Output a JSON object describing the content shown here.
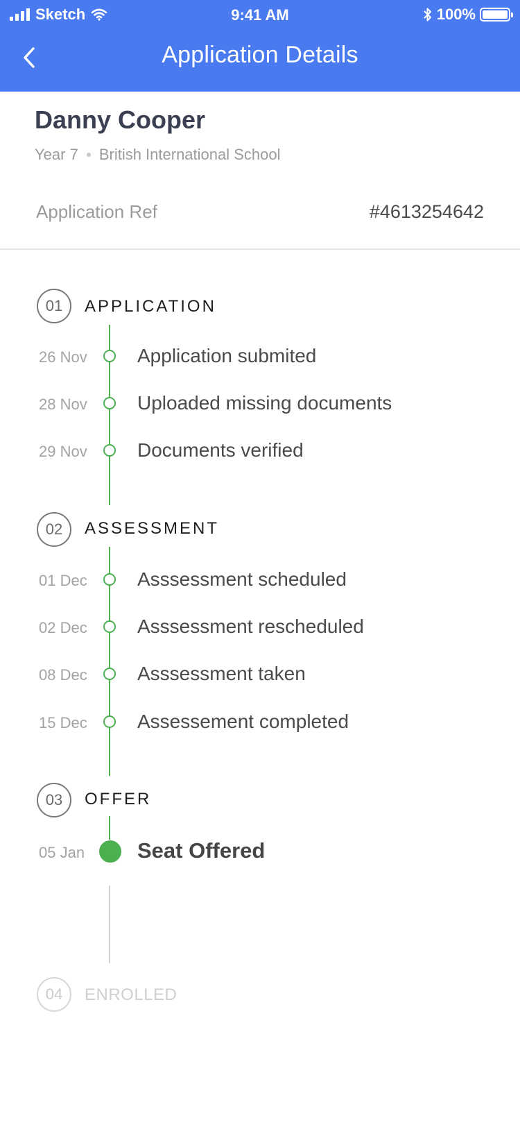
{
  "status_bar": {
    "carrier": "Sketch",
    "time": "9:41 AM",
    "battery_percent": "100%",
    "signal_bars": 4
  },
  "header": {
    "title": "Application Details",
    "back_icon": "chevron-left-icon",
    "background_color": "#4a7af0"
  },
  "profile": {
    "name": "Danny Cooper",
    "year": "Year 7",
    "school": "British International School"
  },
  "application_ref": {
    "label": "Application Ref",
    "value": "#4613254642"
  },
  "stages": [
    {
      "number": "01",
      "title": "APPLICATION",
      "events": [
        {
          "date": "26 Nov",
          "label": "Application submited"
        },
        {
          "date": "28 Nov",
          "label": "Uploaded missing documents"
        },
        {
          "date": "29 Nov",
          "label": "Documents verified"
        }
      ]
    },
    {
      "number": "02",
      "title": "ASSESSMENT",
      "events": [
        {
          "date": "01 Dec",
          "label": "Asssessment scheduled"
        },
        {
          "date": "02 Dec",
          "label": "Asssessment rescheduled"
        },
        {
          "date": "08 Dec",
          "label": "Asssessment taken"
        },
        {
          "date": "15 Dec",
          "label": "Assessement completed"
        }
      ]
    },
    {
      "number": "03",
      "title": "OFFER",
      "events": [
        {
          "date": "05 Jan",
          "label": "Seat Offered"
        }
      ]
    },
    {
      "number": "04",
      "title": "ENROLLED",
      "events": []
    }
  ],
  "colors": {
    "accent": "#4a7af0",
    "complete": "#4caf50",
    "pending": "#d0d0d0"
  }
}
